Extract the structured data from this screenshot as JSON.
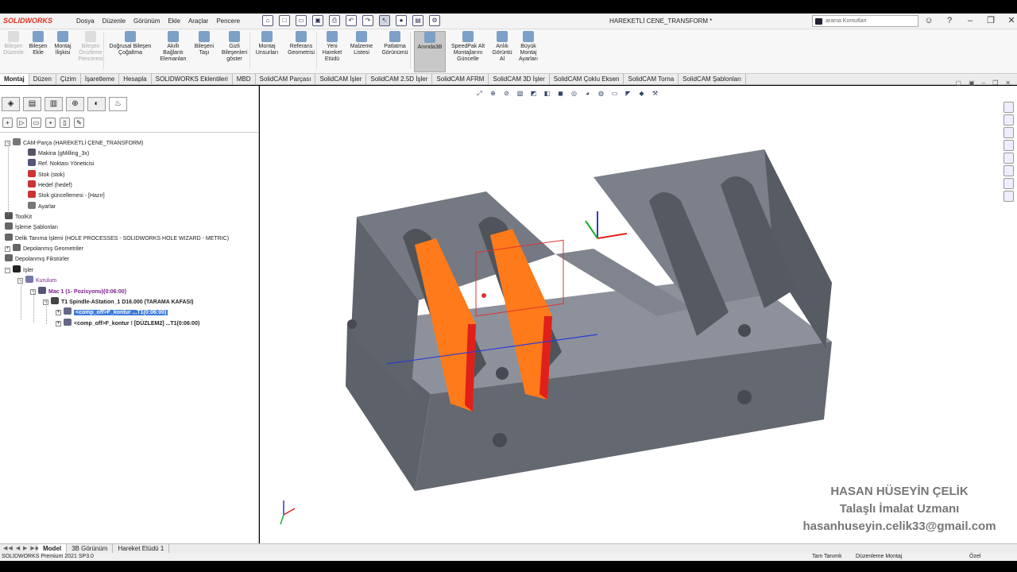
{
  "app": {
    "logo": "SOLIDWORKS",
    "doc_title": "HAREKETLİ CENE_TRANSFORM *"
  },
  "menu": [
    "Dosya",
    "Düzenle",
    "Görünüm",
    "Ekle",
    "Araçlar",
    "Pencere"
  ],
  "search": {
    "placeholder": "arama Komutları"
  },
  "ribbon": [
    {
      "label": "Bileşen Düzenle",
      "disabled": true,
      "icon": "edit-component-icon"
    },
    {
      "label": "Bileşen Ekle",
      "disabled": false,
      "icon": "insert-component-icon"
    },
    {
      "label": "Montaj İlişkisi",
      "disabled": false,
      "icon": "mate-icon"
    },
    {
      "label": "Bileşen Önizleme Penceresi",
      "disabled": true,
      "icon": "preview-window-icon"
    },
    {
      "label": "Doğrusal Bileşen Çoğaltma",
      "disabled": false,
      "icon": "linear-pattern-icon"
    },
    {
      "label": "Akıllı Bağlantı Elemanları",
      "disabled": false,
      "icon": "smart-fasteners-icon"
    },
    {
      "label": "Bileşeni Taşı",
      "disabled": false,
      "icon": "move-component-icon"
    },
    {
      "label": "Gizli Bileşenleri göster",
      "disabled": false,
      "icon": "show-hidden-icon"
    },
    {
      "label": "Montaj Unsurları",
      "disabled": false,
      "icon": "assembly-features-icon"
    },
    {
      "label": "Referans Geometrisi",
      "disabled": false,
      "icon": "reference-geometry-icon"
    },
    {
      "label": "Yeni Hareket Etüdü",
      "disabled": false,
      "icon": "motion-study-icon"
    },
    {
      "label": "Malzeme Listesi",
      "disabled": false,
      "icon": "bom-icon"
    },
    {
      "label": "Patlatma Görünümü",
      "disabled": false,
      "icon": "exploded-view-icon"
    },
    {
      "label": "Anında3B",
      "disabled": false,
      "active": true,
      "icon": "instant3d-icon"
    },
    {
      "label": "SpeedPak Alt Montajlarını Güncelle",
      "disabled": false,
      "icon": "speedpak-icon"
    },
    {
      "label": "Anlık Görüntü Al",
      "disabled": false,
      "icon": "snapshot-icon"
    },
    {
      "label": "Büyük Montaj Ayarları",
      "disabled": false,
      "icon": "large-assembly-icon"
    }
  ],
  "tabs": [
    "Montaj",
    "Düzen",
    "Çizim",
    "İşaretleme",
    "Hesapla",
    "SOLIDWORKS Eklentileri",
    "MBD",
    "SolidCAM Parçası",
    "SolidCAM İşler",
    "SolidCAM 2.5D İşler",
    "SolidCAM AFRM",
    "SolidCAM 3D İşler",
    "SolidCAM Çoklu Eksen",
    "SolidCAM Torna",
    "SolidCAM Şablonları"
  ],
  "tree": [
    {
      "label": "CAM-Parça (HAREKETLİ ÇENE_TRANSFORM)",
      "exp": "-",
      "color": "#777"
    },
    {
      "label": "Makina (gMilling_3x)",
      "exp": "",
      "color": "#556"
    },
    {
      "label": "Ref. Noktası Yöneticisi",
      "exp": "",
      "color": "#557"
    },
    {
      "label": "Stok (stok)",
      "exp": "",
      "color": "#c33"
    },
    {
      "label": "Hedef (hedef)",
      "exp": "",
      "color": "#c33"
    },
    {
      "label": "Stok güncellemesi - [Hazır]",
      "exp": "",
      "color": "#c33"
    },
    {
      "label": "Ayarlar",
      "exp": "",
      "color": "#777"
    },
    {
      "label": "ToolKit",
      "exp": "",
      "color": "#555"
    },
    {
      "label": "İşleme Şablonları",
      "exp": "",
      "color": "#666"
    },
    {
      "label": "Delik Tanıma İşlemi (HOLE PROCESSES - SOLIDWORKS HOLE WIZARD - METRIC)",
      "exp": "",
      "color": "#666"
    },
    {
      "label": "Depolanmış Geometriler",
      "exp": "+",
      "color": "#666"
    },
    {
      "label": "Depolanmış Fikstürler",
      "exp": "",
      "color": "#666"
    },
    {
      "label": "İşler",
      "exp": "-",
      "color": "#222"
    },
    {
      "label": "Kurulum",
      "exp": "-",
      "color": "#77a"
    },
    {
      "label": "Mac 1 (1- Pozisyonu)(0:06:00)",
      "exp": "-",
      "color": "#557"
    },
    {
      "label": "T1 Spindle-AStation_1 D16.000  (TARAMA KAFASI)",
      "exp": "-",
      "color": "#444"
    },
    {
      "label": "<comp_off>F_kontur ...T1(0:06:00)",
      "exp": "+",
      "color": "#668"
    },
    {
      "label": "<comp_off>F_kontur ! [DÜZLEM2] ...T1(0:06:00)",
      "exp": "+",
      "color": "#668"
    }
  ],
  "bottom_tabs": [
    "Model",
    "3B Görünüm",
    "Hareket Etüdü 1"
  ],
  "status": {
    "left": "SOLIDWORKS Premium 2021 SP3.0",
    "mid1": "Tam Tanımlı",
    "mid2": "Düzenleme Montaj",
    "right": "Özel"
  },
  "watermark": {
    "name": "HASAN HÜSEYİN ÇELİK",
    "title": "Talaşlı İmalat Uzmanı",
    "email": "hasanhuseyin.celik33@gmail.com"
  },
  "colors": {
    "part_gray": "#6b6f78",
    "toolpath_orange": "#ff7a1a",
    "toolpath_red": "#e0201a",
    "selection_blue": "#3d7bd9"
  }
}
